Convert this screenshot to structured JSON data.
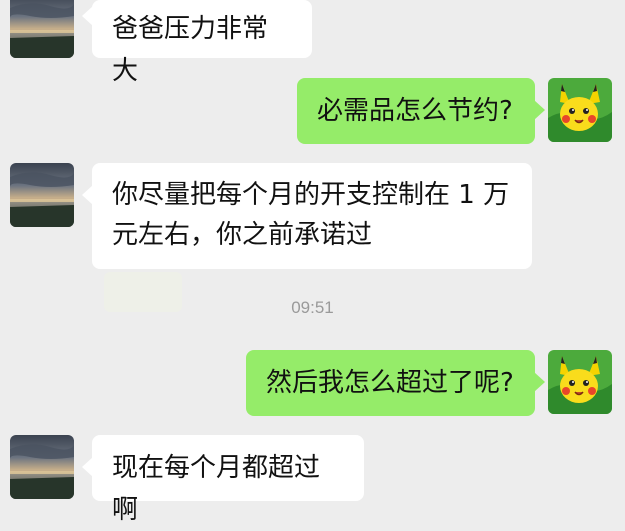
{
  "chat": {
    "timestamp": "09:51",
    "messages": [
      {
        "side": "left",
        "text": "爸爸压力非常大",
        "avatar_icon": "sunset-landscape-avatar-icon"
      },
      {
        "side": "right",
        "text": "必需品怎么节约?",
        "avatar_icon": "pikachu-avatar-icon"
      },
      {
        "side": "left",
        "line1": "你尽量把每个月的开支控制在 1 万",
        "line2": "元左右，你之前承诺过",
        "avatar_icon": "sunset-landscape-avatar-icon"
      },
      {
        "side": "right",
        "text": "然后我怎么超过了呢?",
        "avatar_icon": "pikachu-avatar-icon"
      },
      {
        "side": "left",
        "text": "现在每个月都超过啊",
        "avatar_icon": "sunset-landscape-avatar-icon"
      }
    ]
  },
  "colors": {
    "background": "#ededed",
    "incoming_bubble": "#ffffff",
    "outgoing_bubble": "#95ec69",
    "timestamp_text": "#9a9a9a"
  }
}
